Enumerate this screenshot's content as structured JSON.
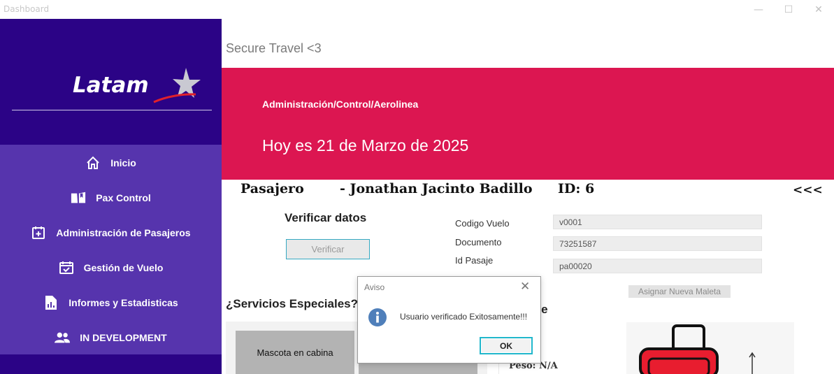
{
  "window": {
    "title": "Dashboard",
    "controls": {
      "minimize": "—",
      "maximize": "☐",
      "close": "✕"
    }
  },
  "sidebar": {
    "logo_text": "Latam",
    "items": [
      {
        "label": "Inicio",
        "icon": "home-icon"
      },
      {
        "label": "Pax Control",
        "icon": "book-icon"
      },
      {
        "label": "Administración de Pasajeros",
        "icon": "calendar-plus-icon"
      },
      {
        "label": "Gestión de Vuelo",
        "icon": "calendar-check-icon"
      },
      {
        "label": "Informes y Estadisticas",
        "icon": "report-icon"
      },
      {
        "label": "IN DEVELOPMENT",
        "icon": "people-icon"
      }
    ]
  },
  "header": {
    "brand": "Secure Travel <3",
    "breadcrumb": "Administración/Control/Aerolinea",
    "date": "Hoy es 21 de Marzo de 2025"
  },
  "passenger": {
    "label": "Pasajero",
    "name": "- Jonathan Jacinto Badillo",
    "id": "ID: 6",
    "back": "<<<"
  },
  "verify": {
    "title": "Verificar datos",
    "button": "Verificar"
  },
  "fields": [
    {
      "label": "Codigo Vuelo",
      "value": "v0001"
    },
    {
      "label": "Documento",
      "value": "73251587"
    },
    {
      "label": "Id Pasaje",
      "value": "pa00020"
    }
  ],
  "services": {
    "title": "¿Servicios Especiales?",
    "cards": [
      "Mascota en cabina",
      ""
    ]
  },
  "luggage": {
    "assign_button": "Asignar Nueva Maleta",
    "title_fragment": "aje",
    "weight": "Peso: N/A"
  },
  "dialog": {
    "title": "Aviso",
    "message": "Usuario verificado Exitosamente!!!",
    "ok": "OK",
    "close": "✕"
  },
  "colors": {
    "sidebar_dark": "#2b0386",
    "sidebar_menu": "#5634ad",
    "banner": "#dc1651",
    "accent": "#21b7cc"
  }
}
